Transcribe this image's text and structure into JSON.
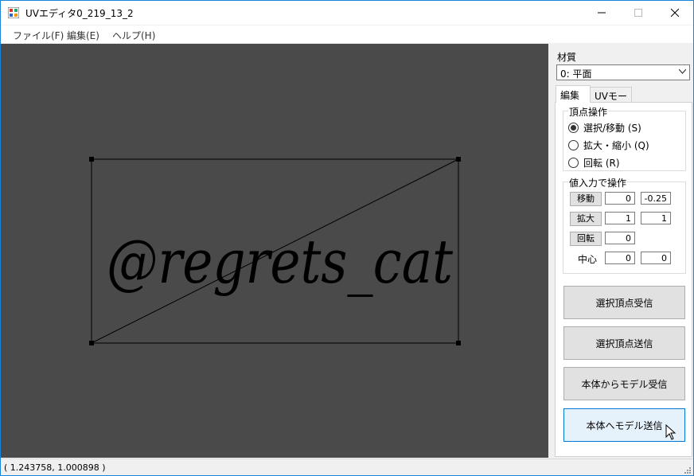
{
  "window": {
    "title": "UVエディタ0_219_13_2"
  },
  "menu": {
    "items": [
      "ファイル(F)",
      "編集(E)",
      "ヘルプ(H)"
    ]
  },
  "panel": {
    "material_label": "材質",
    "material_value": "0: 平面",
    "tabs": [
      "編集",
      "UVモーフ"
    ],
    "vertex_group_title": "頂点操作",
    "radios": [
      {
        "label": "選択/移動 (S)",
        "checked": true
      },
      {
        "label": "拡大・縮小 (Q)",
        "checked": false
      },
      {
        "label": "回転 (R)",
        "checked": false
      }
    ],
    "value_group_title": "値入力で操作",
    "move_label": "移動",
    "move_x": "0",
    "move_y": "-0.25",
    "scale_label": "拡大",
    "scale_x": "1",
    "scale_y": "1",
    "rotate_label": "回転",
    "rotate_val": "0",
    "center_label": "中心",
    "center_x": "0",
    "center_y": "0",
    "buttons": [
      "選択頂点受信",
      "選択頂点送信",
      "本体からモデル受信",
      "本体へモデル送信"
    ]
  },
  "canvas": {
    "texture_text": "@regrets_cat"
  },
  "status": {
    "coords": "( 1.243758, 1.000898 )"
  }
}
